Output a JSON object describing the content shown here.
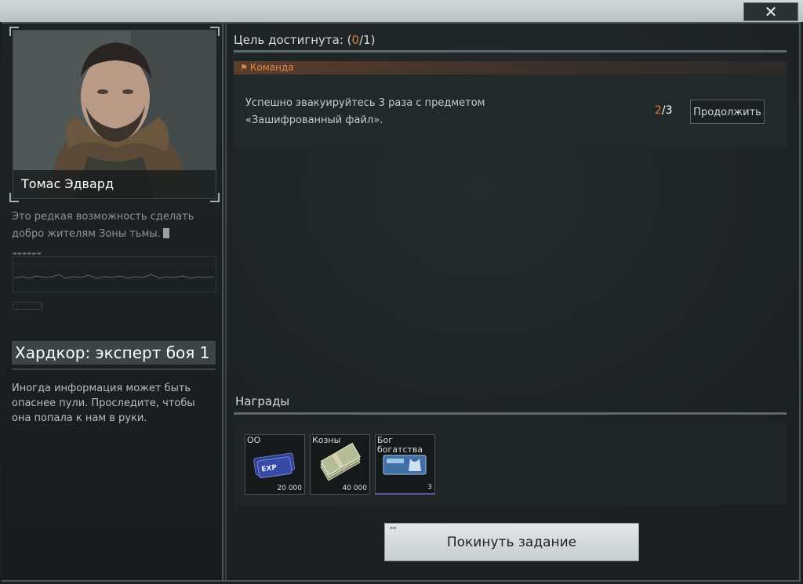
{
  "window": {
    "close_label": "✕"
  },
  "trader": {
    "name": "Томас Эдвард",
    "quote": "Это редкая возможность сделать добро жителям Зоны тьмы."
  },
  "quest": {
    "title": "Хардкор: эксперт боя 1",
    "description": "Иногда информация может быть опаснее пули. Проследите, чтобы она попала к нам в руки."
  },
  "objectives": {
    "header_prefix": "Цель достигнута: (",
    "completed": "0",
    "total_suffix": "/1)",
    "team_label": "Команда",
    "items": [
      {
        "text": "Успешно эвакуируйтесь 3 раза с предметом «Зашифрованный файл».",
        "progress_done": "2",
        "progress_total": "/3",
        "action_label": "Продолжить"
      }
    ]
  },
  "rewards": {
    "header": "Награды",
    "items": [
      {
        "label": "ОО",
        "quantity": "20 000",
        "icon": "exp-ticket-icon"
      },
      {
        "label": "Козны",
        "quantity": "40 000",
        "icon": "cash-stack-icon"
      },
      {
        "label": "Бог богатства",
        "quantity": "3",
        "icon": "wealth-card-icon"
      }
    ]
  },
  "footer": {
    "leave_label": "Покинуть задание"
  }
}
